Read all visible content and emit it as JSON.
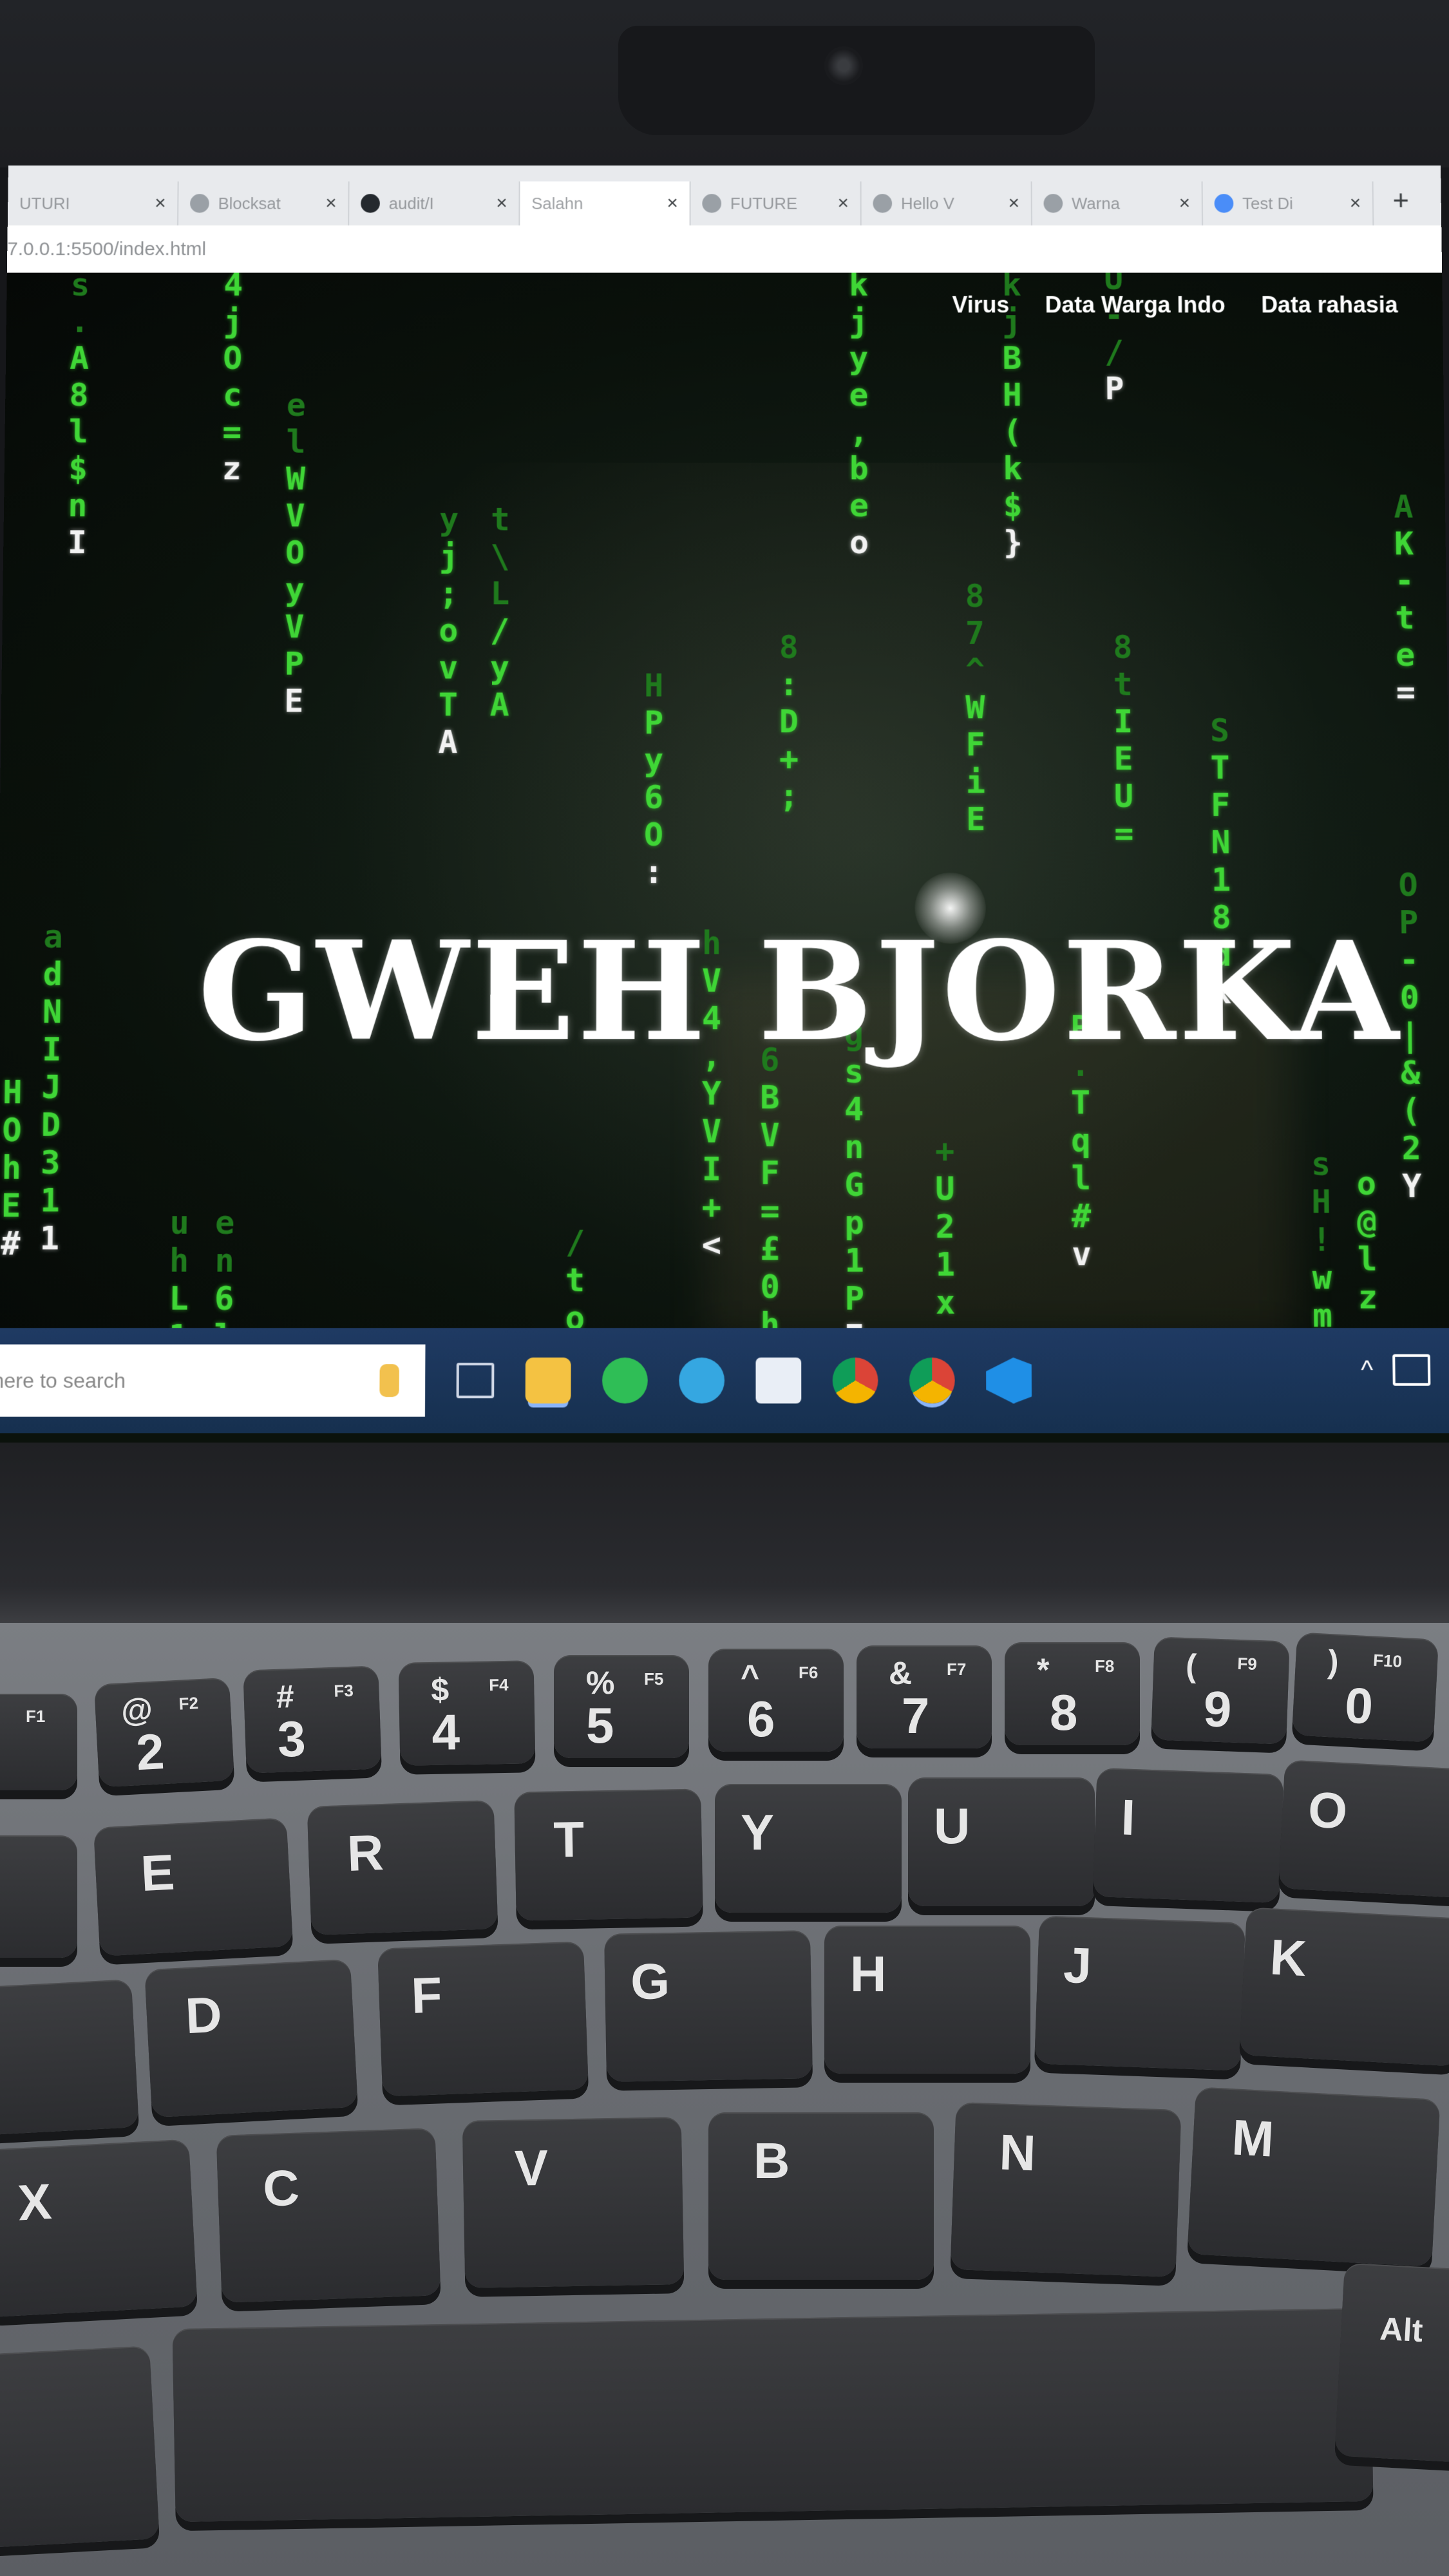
{
  "browser": {
    "tabs": [
      {
        "label": "UTURI",
        "icon": "page-icon",
        "active": false
      },
      {
        "label": "Blocksat",
        "icon": "globe-icon",
        "active": false
      },
      {
        "label": "audit/I",
        "icon": "github-icon",
        "active": false
      },
      {
        "label": "Salahn",
        "icon": "page-icon",
        "active": true
      },
      {
        "label": "FUTURE",
        "icon": "globe-icon",
        "active": false
      },
      {
        "label": "Hello V",
        "icon": "globe-icon",
        "active": false
      },
      {
        "label": "Warna",
        "icon": "globe-icon",
        "active": false
      },
      {
        "label": "Test Di",
        "icon": "edge-icon",
        "active": false
      }
    ],
    "close_glyph": "×",
    "new_tab_glyph": "+",
    "url": "7.0.0.1:5500/index.html"
  },
  "page": {
    "nav": [
      "Virus",
      "Data Warga Indo",
      "Data rahasia"
    ],
    "hero_title": "GWEH BJORKA"
  },
  "taskbar": {
    "search_placeholder": "here to search",
    "apps": [
      "task-view",
      "file-explorer",
      "whatsapp",
      "telegram",
      "discord",
      "chrome",
      "chrome-profile",
      "vscode"
    ],
    "tray_glyph": "^"
  },
  "keyboard": {
    "number_row": [
      {
        "main": "2",
        "sym": "@",
        "fn": "F2"
      },
      {
        "main": "3",
        "sym": "#",
        "fn": "F3"
      },
      {
        "main": "4",
        "sym": "$",
        "fn": "F4"
      },
      {
        "main": "5",
        "sym": "%",
        "fn": "F5"
      },
      {
        "main": "6",
        "sym": "^",
        "fn": "F6"
      },
      {
        "main": "7",
        "sym": "&",
        "fn": "F7"
      },
      {
        "main": "8",
        "sym": "*",
        "fn": "F8"
      },
      {
        "main": "9",
        "sym": "(",
        "fn": "F9"
      },
      {
        "main": "0",
        "sym": ")",
        "fn": "F10"
      }
    ],
    "f1": "F1",
    "top_row": [
      "E",
      "R",
      "T",
      "Y",
      "U",
      "I",
      "O"
    ],
    "home_row": [
      "D",
      "F",
      "G",
      "H",
      "J",
      "K"
    ],
    "bottom_row": [
      "X",
      "C",
      "V",
      "B",
      "N",
      "M"
    ],
    "alt": "Alt"
  },
  "colors": {
    "matrix_green": "#3fd636",
    "taskbar_blue": "#1f3a63"
  }
}
